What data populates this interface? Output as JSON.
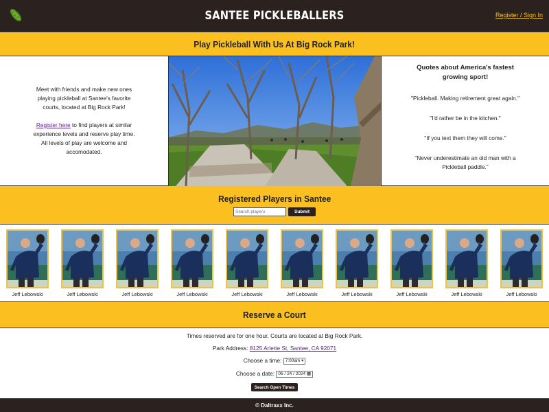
{
  "header": {
    "site_title": "SANTEE PICKLEBALLERS",
    "signin_link": "Register / Sign In",
    "logo_icon": "pickle-icon"
  },
  "hero": {
    "heading": "Play Pickleball With Us At Big Rock Park!",
    "intro": "Meet with friends and make new ones playing pickleball at Santee's favorite courts, located at Big Rock Park!",
    "register_link": "Register here",
    "register_text": " to find players at similar experience levels and reserve play time. All levels of play are welcome and accomodated.",
    "quotes_title": "Quotes about America's fastest growing sport!",
    "quotes": [
      "\"Pickleball. Making retirement great again.\"",
      "\"I'd rather be in the kitchen.\"",
      "\"If you text them they will come.\"",
      "\"Never underestimate an old man with a Pickleball paddle.\""
    ]
  },
  "players_section": {
    "heading": "Registered Players in Santee",
    "search_placeholder": "Search players",
    "search_button": "Submit",
    "players": [
      {
        "name": "Jeff Lebowski"
      },
      {
        "name": "Jeff Lebowski"
      },
      {
        "name": "Jeff Lebowski"
      },
      {
        "name": "Jeff Lebowski"
      },
      {
        "name": "Jeff Lebowski"
      },
      {
        "name": "Jeff Lebowski"
      },
      {
        "name": "Jeff Lebowski"
      },
      {
        "name": "Jeff Lebowski"
      },
      {
        "name": "Jeff Lebowski"
      },
      {
        "name": "Jeff Lebowski"
      }
    ]
  },
  "reserve": {
    "heading": "Reserve a Court",
    "info": "Times reserved are for one hour. Courts are located at Big Rock Park.",
    "address_label": "Park Address: ",
    "address_link": "8125 Arlette St, Santee, CA 92071",
    "time_label": "Choose a time: ",
    "time_value": "7:00am",
    "date_label": "Choose a date: ",
    "date_value": "06 / 24 / 2024",
    "search_button": "Search Open Times"
  },
  "footer": {
    "text": "© Daltraxx Inc."
  },
  "colors": {
    "dark": "#2b221f",
    "accent": "#fbbf1f",
    "link": "#5a1e8a",
    "signin": "#f7c21e"
  }
}
